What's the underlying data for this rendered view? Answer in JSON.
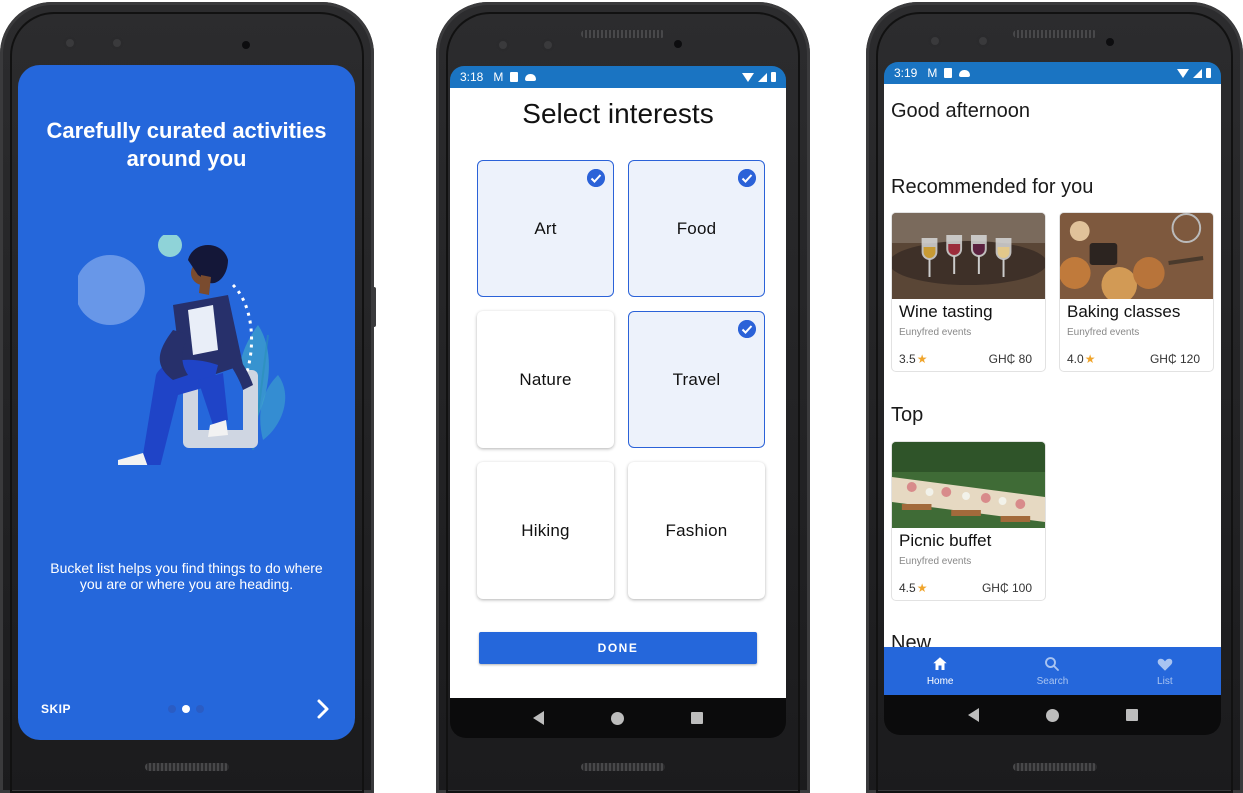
{
  "onboarding": {
    "title": "Carefully curated activities around you",
    "description": "Bucket list helps you find things to do where you are or where you are heading.",
    "skip_label": "SKIP",
    "page_indicator": {
      "total": 3,
      "active_index": 1
    },
    "next_icon": "chevron-right-icon",
    "background_color": "#2567db"
  },
  "interests_screen": {
    "status_time": "3:18",
    "title": "Select interests",
    "items": [
      {
        "label": "Art",
        "selected": true
      },
      {
        "label": "Food",
        "selected": true
      },
      {
        "label": "Nature",
        "selected": false
      },
      {
        "label": "Travel",
        "selected": true
      },
      {
        "label": "Hiking",
        "selected": false
      },
      {
        "label": "Fashion",
        "selected": false
      }
    ],
    "done_label": "DONE"
  },
  "home_screen": {
    "status_time": "3:19",
    "greeting": "Good afternoon",
    "sections": {
      "recommended": "Recommended for you",
      "top": "Top",
      "new": "New"
    },
    "recommended_cards": [
      {
        "title": "Wine tasting",
        "organizer": "Eunyfred events",
        "rating": "3.5",
        "price": "GH₵ 80"
      },
      {
        "title": "Baking classes",
        "organizer": "Eunyfred events",
        "rating": "4.0",
        "price": "GH₵ 120"
      }
    ],
    "top_cards": [
      {
        "title": "Picnic buffet",
        "organizer": "Eunyfred events",
        "rating": "4.5",
        "price": "GH₵ 100"
      }
    ],
    "bottom_nav": [
      {
        "label": "Home",
        "icon": "home-icon",
        "active": true
      },
      {
        "label": "Search",
        "icon": "search-icon",
        "active": false
      },
      {
        "label": "List",
        "icon": "heart-icon",
        "active": false
      }
    ],
    "accent_color": "#2567db",
    "star_color": "#f0a52c"
  }
}
